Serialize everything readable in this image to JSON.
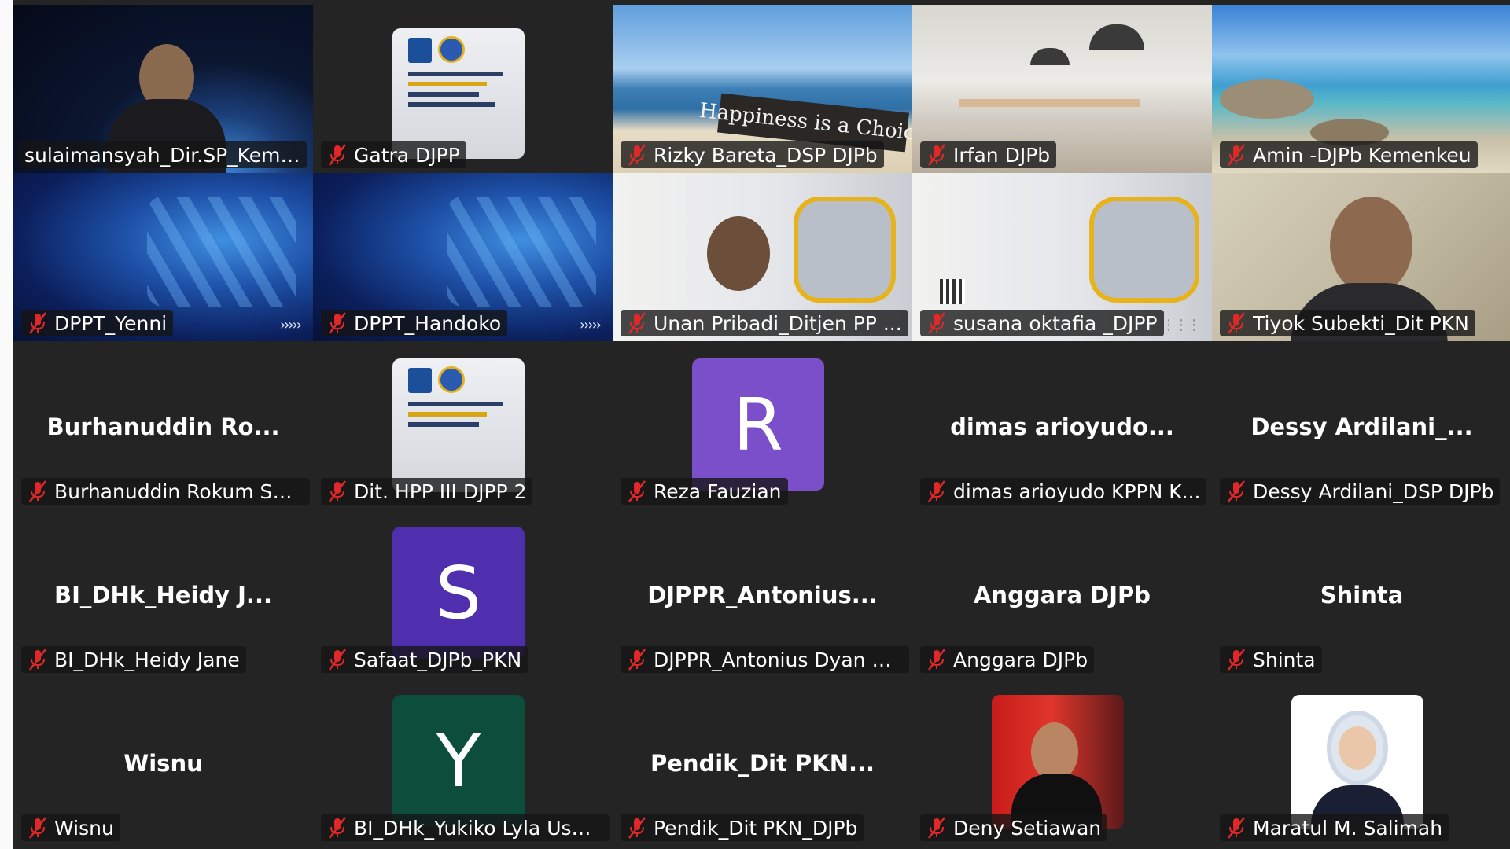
{
  "participants": [
    {
      "name": "sulaimansyah_Dir.SP_Keme..."
    },
    {
      "name": "Gatra DJPP"
    },
    {
      "name": "Rizky Bareta_DSP DJPb",
      "banner_text": "Happiness is a Choice"
    },
    {
      "name": "Irfan DJPb"
    },
    {
      "name": "Amin -DJPb Kemenkeu"
    },
    {
      "name": "DPPT_Yenni"
    },
    {
      "name": "DPPT_Handoko"
    },
    {
      "name": "Unan Pribadi_Ditjen PP ..."
    },
    {
      "name": "susana oktafia _DJPP"
    },
    {
      "name": "Tiyok Subekti_Dit PKN"
    },
    {
      "name": "Burhanuddin Rokum Setj...",
      "display_name": "Burhanuddin  Ro..."
    },
    {
      "name": "Dit. HPP III DJPP 2"
    },
    {
      "name": "Reza Fauzian",
      "initial": "R",
      "avatar_color": "#7b4fc9"
    },
    {
      "name": "dimas arioyudo KPPN K...",
      "display_name": "dimas  arioyudo..."
    },
    {
      "name": "Dessy Ardilani_DSP DJPb",
      "display_name": "Dessy  Ardilani_..."
    },
    {
      "name": "BI_DHk_Heidy Jane",
      "display_name": "BI_DHk_Heidy  J..."
    },
    {
      "name": "Safaat_DJPb_PKN",
      "initial": "S",
      "avatar_color": "#4f2fae"
    },
    {
      "name": "DJPPR_Antonius Dyan N...",
      "display_name": "DJPPR_Antonius..."
    },
    {
      "name": "Anggara DJPb",
      "display_name": "Anggara DJPb"
    },
    {
      "name": "Shinta",
      "display_name": "Shinta"
    },
    {
      "name": "Wisnu",
      "display_name": "Wisnu"
    },
    {
      "name": "BI_DHk_Yukiko Lyla Usman",
      "initial": "Y",
      "avatar_color": "#0c4d3c"
    },
    {
      "name": "Pendik_Dit PKN_DJPb",
      "display_name": "Pendik_Dit  PKN..."
    },
    {
      "name": "Deny Setiawan"
    },
    {
      "name": "Maratul M. Salimah"
    }
  ],
  "colors": {
    "gallery_bg": "#242424",
    "active_speaker_border": "#23d959",
    "muted_mic": "#e02828"
  },
  "icons": {
    "muted": "muted-mic-icon"
  }
}
